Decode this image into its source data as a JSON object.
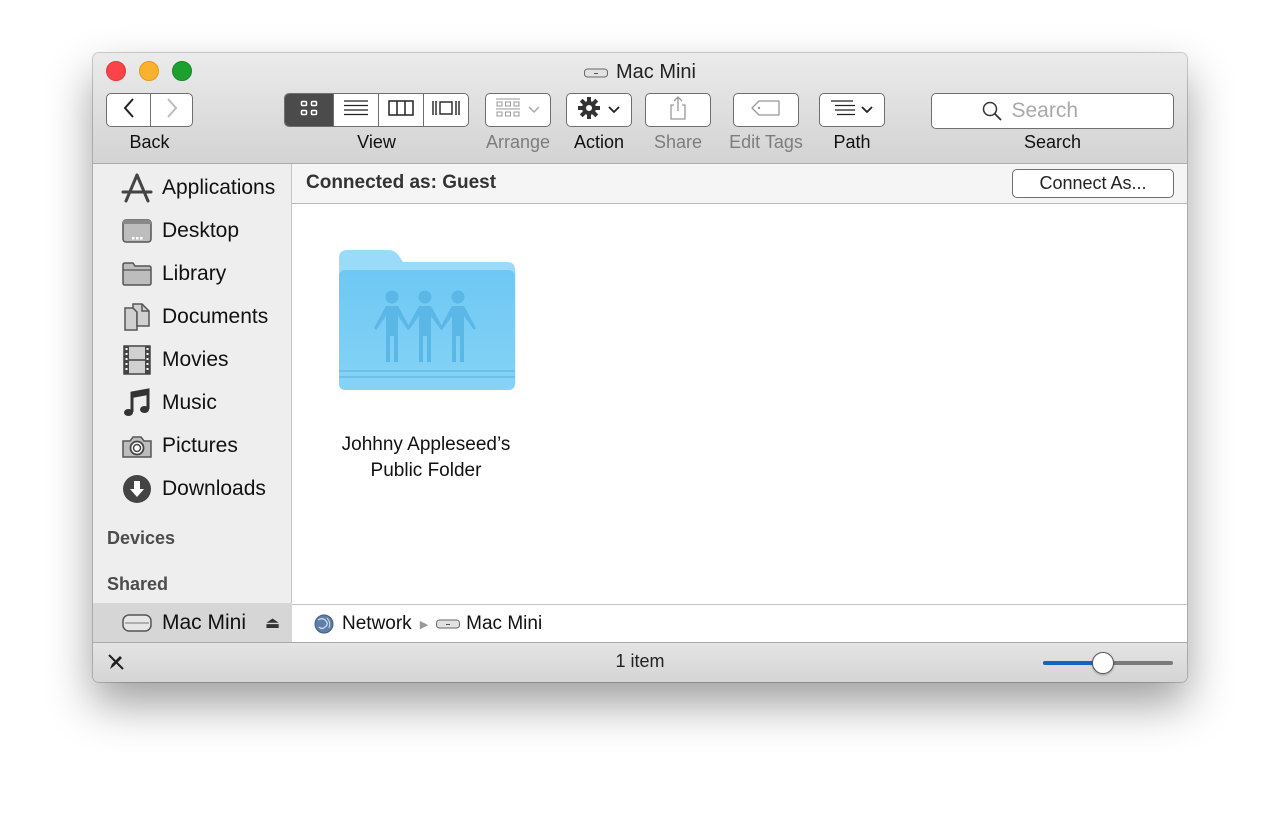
{
  "window": {
    "title": "Mac Mini",
    "title_icon": "mac-mini-icon",
    "traffic_lights": {
      "close": "#fc4448",
      "minimize": "#f8b22e",
      "maximize": "#1ea02f"
    }
  },
  "toolbar": {
    "back_label": "Back",
    "view_label": "View",
    "view_modes": [
      "icon-view",
      "list-view",
      "column-view",
      "cover-flow-view"
    ],
    "view_active": "icon-view",
    "arrange_label": "Arrange",
    "action_label": "Action",
    "share_label": "Share",
    "edit_tags_label": "Edit Tags",
    "path_label": "Path",
    "search_label": "Search",
    "search_placeholder": "Search",
    "search_value": ""
  },
  "sidebar": {
    "favorites": [
      {
        "label": "Applications",
        "icon": "applications-icon"
      },
      {
        "label": "Desktop",
        "icon": "desktop-icon"
      },
      {
        "label": "Library",
        "icon": "folder-icon"
      },
      {
        "label": "Documents",
        "icon": "documents-icon"
      },
      {
        "label": "Movies",
        "icon": "movies-icon"
      },
      {
        "label": "Music",
        "icon": "music-icon"
      },
      {
        "label": "Pictures",
        "icon": "camera-icon"
      },
      {
        "label": "Downloads",
        "icon": "downloads-icon"
      }
    ],
    "devices_heading": "Devices",
    "shared_heading": "Shared",
    "shared_items": [
      {
        "label": "Mac Mini",
        "icon": "mac-mini-icon",
        "selected": true,
        "eject": "⏏"
      }
    ]
  },
  "content": {
    "connected_as": "Connected as: Guest",
    "connect_as_button": "Connect As...",
    "items": [
      {
        "name_line1": "Johhny Appleseed’s",
        "name_line2": "Public Folder",
        "icon": "public-folder-icon"
      }
    ]
  },
  "path_bar": {
    "segments": [
      {
        "label": "Network",
        "icon": "network-globe-icon"
      },
      {
        "label": "Mac Mini",
        "icon": "mac-mini-icon"
      }
    ],
    "separator": "▶"
  },
  "status_bar": {
    "item_count": "1 item",
    "icon_size_fraction": 0.45
  },
  "colors": {
    "folder_blue": "#6cc6f2",
    "slider_fill": "#1663c7"
  }
}
